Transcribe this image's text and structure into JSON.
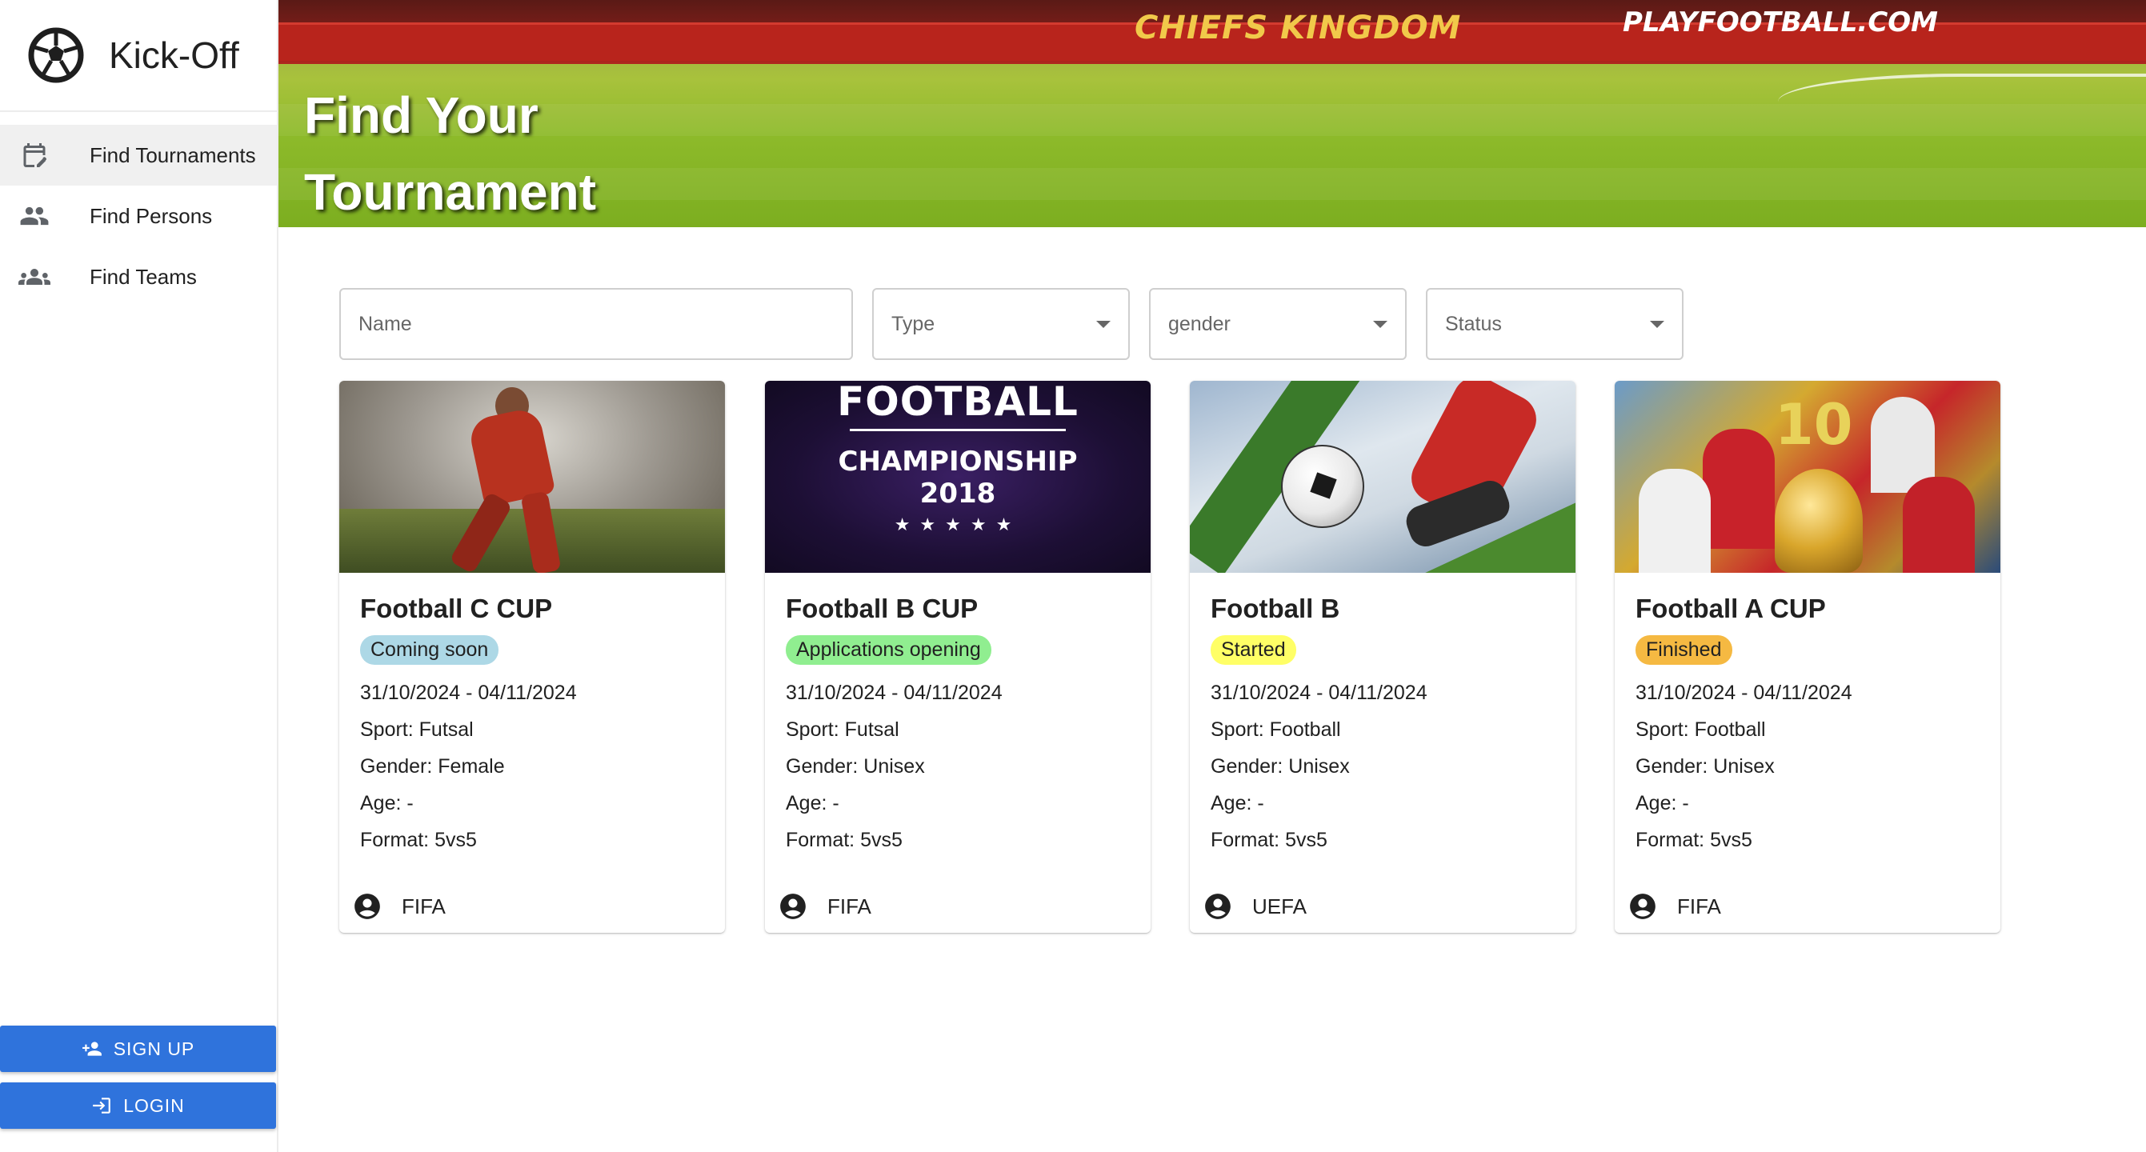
{
  "app": {
    "name": "Kick-Off"
  },
  "sidebar": {
    "items": [
      {
        "label": "Find Tournaments",
        "icon": "calendar-edit-icon",
        "active": true
      },
      {
        "label": "Find Persons",
        "icon": "people-icon",
        "active": false
      },
      {
        "label": "Find Teams",
        "icon": "groups-icon",
        "active": false
      }
    ],
    "signup_label": "SIGN UP",
    "login_label": "LOGIN"
  },
  "banner": {
    "title": "Find Your Tournament",
    "stands_text": "CHIEFS KINGDOM",
    "stands_text2": "PLAYFOOTBALL.COM"
  },
  "filters": {
    "name_placeholder": "Name",
    "type_label": "Type",
    "gender_label": "gender",
    "status_label": "Status"
  },
  "cards": [
    {
      "title": "Football C CUP",
      "status": "Coming soon",
      "status_color": "#add8e6",
      "dates": "31/10/2024 - 04/11/2024",
      "sport": "Sport: Futsal",
      "gender": "Gender: Female",
      "age": "Age: -",
      "format": "Format: 5vs5",
      "organizer": "FIFA"
    },
    {
      "title": "Football B CUP",
      "status": "Applications opening",
      "status_color": "#90ee90",
      "dates": "31/10/2024 - 04/11/2024",
      "sport": "Sport: Futsal",
      "gender": "Gender: Unisex",
      "age": "Age: -",
      "format": "Format: 5vs5",
      "organizer": "FIFA",
      "image_text": {
        "line1": "FOOTBALL",
        "line2": "CHAMPIONSHIP",
        "line3": "2018",
        "stars": "★★★★★"
      }
    },
    {
      "title": "Football B",
      "status": "Started",
      "status_color": "#ffff66",
      "dates": "31/10/2024 - 04/11/2024",
      "sport": "Sport: Football",
      "gender": "Gender: Unisex",
      "age": "Age: -",
      "format": "Format: 5vs5",
      "organizer": "UEFA"
    },
    {
      "title": "Football A CUP",
      "status": "Finished",
      "status_color": "#f5b942",
      "dates": "31/10/2024 - 04/11/2024",
      "sport": "Sport: Football",
      "gender": "Gender: Unisex",
      "age": "Age: -",
      "format": "Format: 5vs5",
      "organizer": "FIFA",
      "image_text": {
        "number": "10"
      }
    }
  ]
}
